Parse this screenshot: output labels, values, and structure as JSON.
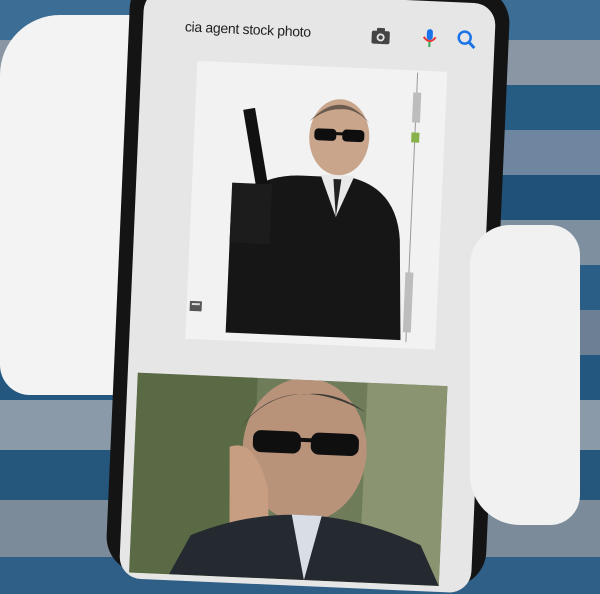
{
  "search": {
    "query": "cia agent stock photo"
  },
  "icons": {
    "camera": "camera-icon",
    "mic": "mic-icon",
    "search": "search-icon",
    "stamp": "watermark-stamp-icon"
  },
  "colors": {
    "mic_accent": "#1a73e8",
    "search_accent": "#1a73e8",
    "background_blue": "#2f5f86",
    "screen_bg": "#e6e6e6"
  },
  "results": [
    {
      "kind": "image-result",
      "subject": "agent-with-gun"
    },
    {
      "kind": "image-result",
      "subject": "agent-with-earpiece"
    }
  ]
}
